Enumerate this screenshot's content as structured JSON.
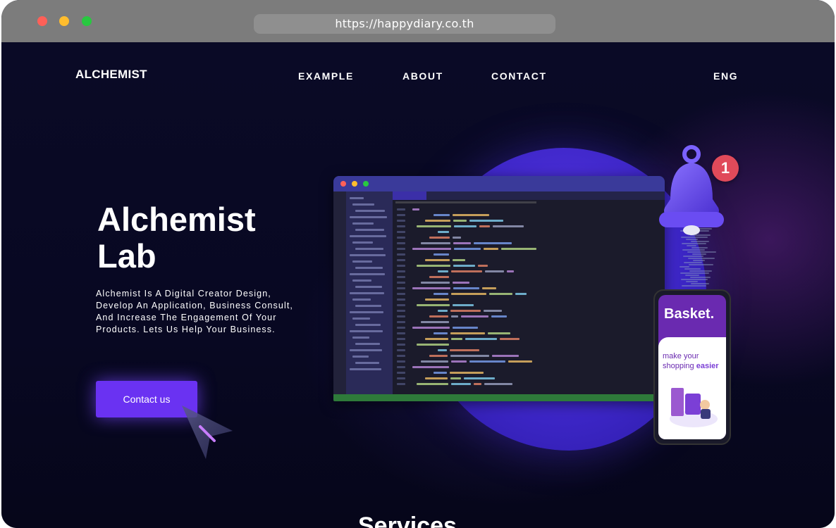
{
  "browser": {
    "url": "https://happydiary.co.th",
    "traffic_lights": {
      "close": "#ff6058",
      "minimize": "#ffbd2e",
      "zoom": "#28c840"
    }
  },
  "nav": {
    "logo": "ALCHEMIST",
    "items": [
      "EXAMPLE",
      "ABOUT",
      "CONTACT"
    ],
    "language": "ENG"
  },
  "hero": {
    "title_line1": "Alchemist",
    "title_line2": "Lab",
    "description": "Alchemist Is A Digital Creator Design, Develop An Application, Business Consult, And Increase The Engagement Of Your Products. Lets Us Help Your Business.",
    "cta_label": "Contact us"
  },
  "illustration": {
    "notification_count": "1",
    "phone_brand": "Basket.",
    "phone_tagline_line1": "make your",
    "phone_tagline_line2_a": "shopping ",
    "phone_tagline_line2_b": "easier"
  },
  "services_heading": "Services",
  "colors": {
    "accent": "#6a32f2",
    "background": "#07071c",
    "badge": "#e04a5a",
    "blob": "#4a30d8"
  }
}
